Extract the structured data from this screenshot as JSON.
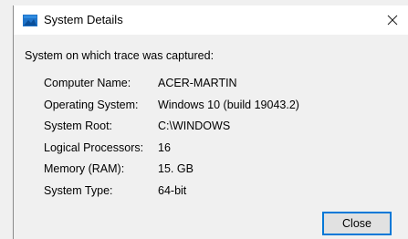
{
  "window": {
    "title": "System Details",
    "title_icon": "window-app-icon",
    "close_glyph": "✕"
  },
  "content": {
    "intro": "System on which trace was captured:",
    "details": [
      {
        "label": "Computer Name:",
        "value": "ACER-MARTIN"
      },
      {
        "label": "Operating System:",
        "value": "Windows 10 (build 19043.2)"
      },
      {
        "label": "System Root:",
        "value": "C:\\WINDOWS"
      },
      {
        "label": "Logical Processors:",
        "value": "16"
      },
      {
        "label": "Memory (RAM):",
        "value": "15. GB"
      },
      {
        "label": "System Type:",
        "value": "64-bit"
      }
    ]
  },
  "buttons": {
    "close_label": "Close"
  },
  "colors": {
    "accent": "#0078d7",
    "dialog_bg": "#f0f0f0",
    "titlebar_bg": "#ffffff"
  }
}
